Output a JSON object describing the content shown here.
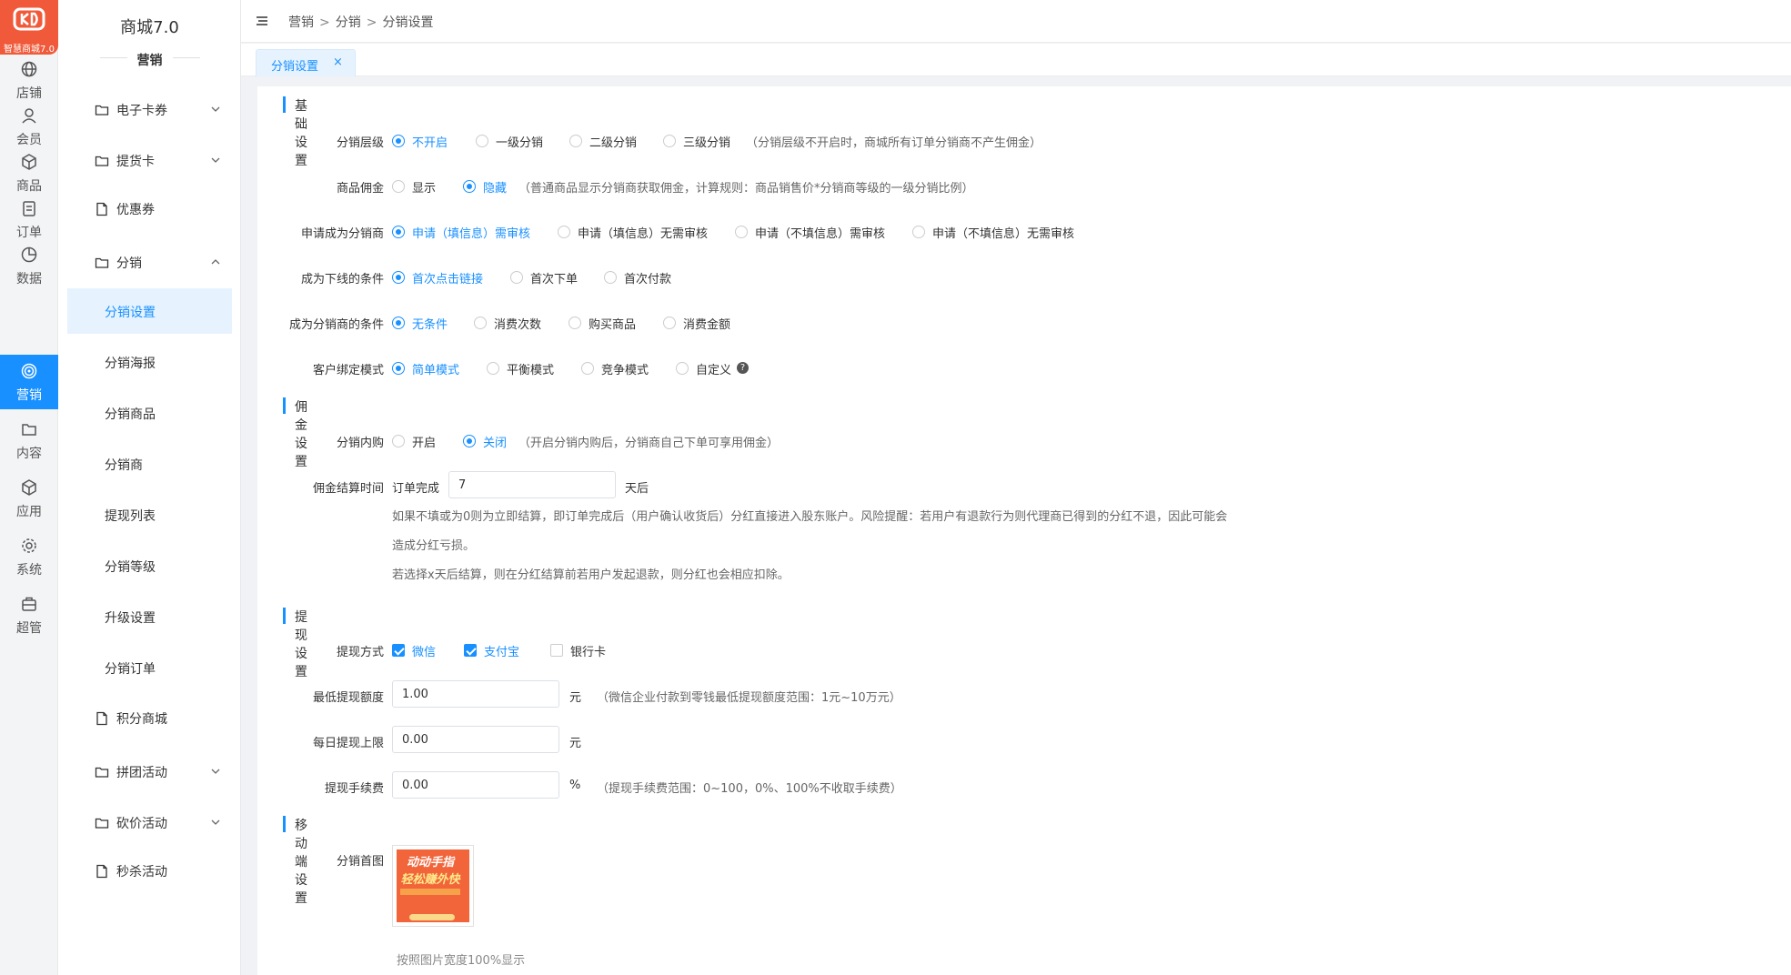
{
  "brand": {
    "logo_text": "智慧商城7.0",
    "logo_mark": "KD",
    "app_title": "商城7.0",
    "section_title": "营销"
  },
  "rail": [
    {
      "label": "店铺",
      "icon": "store-icon"
    },
    {
      "label": "会员",
      "icon": "user-icon"
    },
    {
      "label": "商品",
      "icon": "box-icon"
    },
    {
      "label": "订单",
      "icon": "order-icon"
    },
    {
      "label": "数据",
      "icon": "chart-icon"
    },
    {
      "label": "营销",
      "icon": "target-icon",
      "active": true
    },
    {
      "label": "内容",
      "icon": "folder-icon"
    },
    {
      "label": "应用",
      "icon": "package-icon"
    },
    {
      "label": "系统",
      "icon": "gear-icon"
    },
    {
      "label": "超管",
      "icon": "briefcase-icon"
    }
  ],
  "sidebar": {
    "menus": [
      {
        "label": "电子卡券",
        "icon": "folder-icon",
        "arrow": "down"
      },
      {
        "label": "提货卡",
        "icon": "folder-icon",
        "arrow": "down"
      },
      {
        "label": "优惠券",
        "icon": "file-icon"
      },
      {
        "label": "分销",
        "icon": "folder-icon",
        "arrow": "up"
      },
      {
        "label": "积分商城",
        "icon": "file-icon"
      },
      {
        "label": "拼团活动",
        "icon": "folder-icon",
        "arrow": "down"
      },
      {
        "label": "砍价活动",
        "icon": "folder-icon",
        "arrow": "down"
      },
      {
        "label": "秒杀活动",
        "icon": "file-icon"
      }
    ],
    "sub_items": [
      {
        "label": "分销设置",
        "active": true
      },
      {
        "label": "分销海报"
      },
      {
        "label": "分销商品"
      },
      {
        "label": "分销商"
      },
      {
        "label": "提现列表"
      },
      {
        "label": "分销等级"
      },
      {
        "label": "升级设置"
      },
      {
        "label": "分销订单"
      }
    ]
  },
  "breadcrumb": [
    "营销",
    "分销",
    "分销设置"
  ],
  "breadcrumb_sep": ">",
  "tab": {
    "label": "分销设置",
    "close": "×"
  },
  "sections": {
    "basic": "基础设置",
    "commission": "佣金设置",
    "withdraw": "提现设置",
    "mobile": "移动端设置"
  },
  "basic": {
    "level": {
      "label": "分销层级",
      "options": [
        "不开启",
        "一级分销",
        "二级分销",
        "三级分销"
      ],
      "selected": 0,
      "hint": "（分销层级不开启时，商城所有订单分销商不产生佣金）"
    },
    "product_commission": {
      "label": "商品佣金",
      "options": [
        "显示",
        "隐藏"
      ],
      "selected": 1,
      "hint": "（普通商品显示分销商获取佣金，计算规则：商品销售价*分销商等级的一级分销比例）"
    },
    "apply": {
      "label": "申请成为分销商",
      "options": [
        "申请（填信息）需审核",
        "申请（填信息）无需审核",
        "申请（不填信息）需审核",
        "申请（不填信息）无需审核"
      ],
      "selected": 0
    },
    "downline": {
      "label": "成为下线的条件",
      "options": [
        "首次点击链接",
        "首次下单",
        "首次付款"
      ],
      "selected": 0
    },
    "become": {
      "label": "成为分销商的条件",
      "options": [
        "无条件",
        "消费次数",
        "购买商品",
        "消费金额"
      ],
      "selected": 0
    },
    "binding": {
      "label": "客户绑定模式",
      "options": [
        "简单模式",
        "平衡模式",
        "竞争模式",
        "自定义"
      ],
      "selected": 0,
      "help": "?"
    }
  },
  "commission": {
    "self_buy": {
      "label": "分销内购",
      "options": [
        "开启",
        "关闭"
      ],
      "selected": 1,
      "hint": "（开启分销内购后，分销商自己下单可享用佣金）"
    },
    "settle": {
      "label": "佣金结算时间",
      "prefix": "订单完成",
      "value": "7",
      "suffix": "天后",
      "note1": "如果不填或为0则为立即结算，即订单完成后（用户确认收货后）分红直接进入股东账户。风险提醒：若用户有退款行为则代理商已得到的分红不退，因此可能会",
      "note2": "造成分红亏损。",
      "note3": "若选择x天后结算，则在分红结算前若用户发起退款，则分红也会相应扣除。"
    }
  },
  "withdraw": {
    "methods": {
      "label": "提现方式",
      "options": [
        {
          "label": "微信",
          "checked": true
        },
        {
          "label": "支付宝",
          "checked": true
        },
        {
          "label": "银行卡",
          "checked": false
        }
      ]
    },
    "min": {
      "label": "最低提现额度",
      "value": "1.00",
      "unit": "元",
      "hint": "（微信企业付款到零钱最低提现额度范围：1元~10万元）"
    },
    "daily": {
      "label": "每日提现上限",
      "value": "0.00",
      "unit": "元"
    },
    "fee": {
      "label": "提现手续费",
      "value": "0.00",
      "unit": "%",
      "hint": "（提现手续费范围：0~100，0%、100%不收取手续费）"
    }
  },
  "mobile": {
    "banner_label": "分销首图",
    "banner_text1": "动动手指",
    "banner_text2": "轻松赚外快",
    "banner_caption": "按照图片宽度100%显示"
  },
  "colors": {
    "accent": "#1890ff",
    "logo": "#f05a3a"
  }
}
